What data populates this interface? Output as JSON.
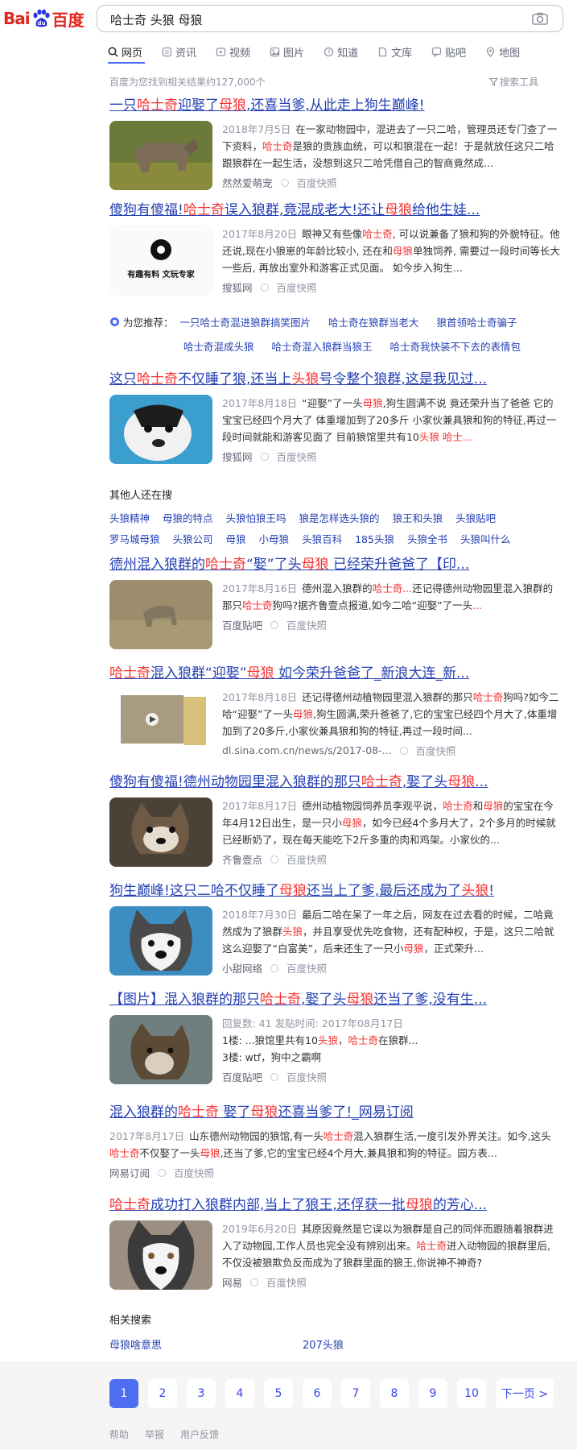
{
  "logo": {
    "part1": "Bai",
    "part2": "百度"
  },
  "search": {
    "query": "哈士奇 头狼 母狼"
  },
  "tabs": [
    {
      "label": "网页",
      "icon": "search-icon",
      "active": true
    },
    {
      "label": "资讯",
      "icon": "news-icon"
    },
    {
      "label": "视频",
      "icon": "video-icon"
    },
    {
      "label": "图片",
      "icon": "image-icon"
    },
    {
      "label": "知道",
      "icon": "question-icon"
    },
    {
      "label": "文库",
      "icon": "document-icon"
    },
    {
      "label": "贴吧",
      "icon": "forum-icon"
    },
    {
      "label": "地图",
      "icon": "map-icon"
    }
  ],
  "result_count": "百度为您找到相关结果约127,000个",
  "tools_label": "搜索工具",
  "results": [
    {
      "title": [
        [
          "一只",
          ""
        ],
        [
          "哈士奇",
          "hl"
        ],
        [
          "迎娶了",
          ""
        ],
        [
          "母狼",
          "hl"
        ],
        [
          ",还喜当爹,从此走上狗生巅峰!",
          ""
        ]
      ],
      "text": [
        [
          "2018年7月5日",
          "date"
        ],
        [
          "在一家动物园中，混进去了一只二哈，管理员还专门查了一下资料，",
          ""
        ],
        [
          "哈士奇",
          "hl"
        ],
        [
          "是狼的贵族血统，可以和狼混在一起！于是就放任这只二哈跟狼群在一起生活，没想到这只二哈凭借自己的智商竟然成...",
          ""
        ]
      ],
      "source": "然然爱萌宠",
      "snap": "百度快照",
      "thumb": "wolf-grass"
    },
    {
      "title": [
        [
          "傻狗有傻福!",
          ""
        ],
        [
          "哈士奇",
          "hl"
        ],
        [
          "误入狼群,竟混成老大!还让",
          ""
        ],
        [
          "母狼",
          "hl"
        ],
        [
          "给他生娃...",
          ""
        ]
      ],
      "text": [
        [
          "2017年8月20日",
          "date"
        ],
        [
          "眼神又有些像",
          ""
        ],
        [
          "哈士奇",
          "hl"
        ],
        [
          ", 可以说兼备了狼和狗的外貌特征。他还说,现在小狼崽的年龄比较小, 还在和",
          ""
        ],
        [
          "母狼",
          "hl"
        ],
        [
          "单独饲养, 需要过一段时间等长大一些后, 再放出室外和游客正式见面。 如今步入狗生...",
          ""
        ]
      ],
      "source": "搜狐网",
      "snap": "百度快照",
      "thumb": "logo-card",
      "thumb_text": "有趣有料 文玩专家"
    },
    {
      "title": [
        [
          "这只",
          ""
        ],
        [
          "哈士奇",
          "hl"
        ],
        [
          "不仅睡了狼,还当上",
          ""
        ],
        [
          "头狼",
          "hl"
        ],
        [
          "号令整个狼群,这是我见过...",
          ""
        ]
      ],
      "text": [
        [
          "2017年8月18日",
          "date"
        ],
        [
          "“迎娶”了一头",
          ""
        ],
        [
          "母狼",
          "hl"
        ],
        [
          ",狗生圆满不说 竟还荣升当了爸爸 它的宝宝已经四个月大了 体重增加到了20多斤 小家伙兼具狼和狗的特征,再过一段时间就能和游客见面了 目前狼馆里共有10",
          ""
        ],
        [
          "头狼",
          "hl"
        ],
        [
          " ",
          ""
        ],
        [
          "哈士...",
          "hl"
        ]
      ],
      "source": "搜狐网",
      "snap": "百度快照",
      "thumb": "husky-face"
    },
    {
      "title": [
        [
          "德州混入狼群的",
          ""
        ],
        [
          "哈士奇",
          "hl"
        ],
        [
          "“娶”了头",
          ""
        ],
        [
          "母狼",
          "hl"
        ],
        [
          " 已经荣升爸爸了【印...",
          ""
        ]
      ],
      "text": [
        [
          "2017年8月16日",
          "date"
        ],
        [
          "德州混入狼群的",
          ""
        ],
        [
          "哈士奇...",
          "hl"
        ],
        [
          "还记得德州动物园里混入狼群的那只",
          ""
        ],
        [
          "哈士奇",
          "hl"
        ],
        [
          "狗吗?据齐鲁壹点报道,如今二哈“迎娶”了一头",
          ""
        ],
        [
          "...",
          "hl"
        ]
      ],
      "source": "百度贴吧",
      "snap": "百度快照",
      "thumb": "wolf-field"
    },
    {
      "title": [
        [
          "哈士奇",
          "hl"
        ],
        [
          "混入狼群“迎娶”",
          ""
        ],
        [
          "母狼",
          "hl"
        ],
        [
          " 如今荣升爸爸了_新浪大连_新...",
          ""
        ]
      ],
      "text": [
        [
          "2017年8月18日",
          "date"
        ],
        [
          "还记得德州动植物园里混入狼群的那只",
          ""
        ],
        [
          "哈士奇",
          "hl"
        ],
        [
          "狗吗?如今二哈“迎娶”了一头",
          ""
        ],
        [
          "母狼",
          "hl"
        ],
        [
          ",狗生圆满,荣升爸爸了,它的宝宝已经四个月大了,体重增加到了20多斤,小家伙兼具狼和狗的特征,再过一段时间...",
          ""
        ]
      ],
      "source": "dl.sina.com.cn/news/s/2017-08-...",
      "snap": "百度快照",
      "thumb": "video-card"
    },
    {
      "title": [
        [
          "傻狗有傻福!德州动物园里混入狼群的那只",
          ""
        ],
        [
          "哈士奇",
          "hl"
        ],
        [
          ",娶了头",
          ""
        ],
        [
          "母狼",
          "hl"
        ],
        [
          "...",
          ""
        ]
      ],
      "text": [
        [
          "2017年8月17日",
          "date"
        ],
        [
          "德州动植物园饲养员李观平说，",
          ""
        ],
        [
          "哈士奇",
          "hl"
        ],
        [
          "和",
          ""
        ],
        [
          "母狼",
          "hl"
        ],
        [
          "的宝宝在今年4月12日出生，是一只小",
          ""
        ],
        [
          "母狼",
          "hl"
        ],
        [
          "，如今已经4个多月大了，2个多月的时候就已经断奶了，现在每天能吃下2斤多重的肉和鸡架。小家伙的...",
          ""
        ]
      ],
      "source": "齐鲁壹点",
      "snap": "百度快照",
      "thumb": "wolf-pup"
    },
    {
      "title": [
        [
          "狗生巅峰!这只二哈不仅睡了",
          ""
        ],
        [
          "母狼",
          "hl"
        ],
        [
          "还当上了爹,最后还成为了",
          ""
        ],
        [
          "头狼",
          "hl"
        ],
        [
          "!",
          ""
        ]
      ],
      "text": [
        [
          "2018年7月30日",
          "date"
        ],
        [
          "最后二哈在呆了一年之后，网友在过去看的时候，二哈竟然成为了狼群",
          ""
        ],
        [
          "头狼",
          "hl"
        ],
        [
          "，并且享受优先吃食物，还有配种权，于是，这只二哈就这么迎娶了“白富美”，后来还生了一只小",
          ""
        ],
        [
          "母狼",
          "hl"
        ],
        [
          "，正式荣升...",
          ""
        ]
      ],
      "source": "小甜网络",
      "snap": "百度快照",
      "thumb": "husky-sad"
    },
    {
      "title": [
        [
          "【图片】混入狼群的那只",
          ""
        ],
        [
          "哈士奇",
          "hl"
        ],
        [
          ",娶了头",
          ""
        ],
        [
          "母狼",
          "hl"
        ],
        [
          "还当了爹,没有生...",
          ""
        ]
      ],
      "text": [
        [
          "回复数: 41 发贴时间: 2017年08月17日",
          "date"
        ],
        [
          "",
          ""
        ]
      ],
      "text2": [
        [
          "1楼: ...狼馆里共有10",
          ""
        ],
        [
          "头狼",
          "hl"
        ],
        [
          "，",
          ""
        ],
        [
          "哈士奇",
          "hl"
        ],
        [
          "在狼群...",
          ""
        ]
      ],
      "text3": "3楼: wtf，狗中之霸啊",
      "source": "百度贴吧",
      "snap": "百度快照",
      "thumb": "wolf-dark"
    },
    {
      "title": [
        [
          "混入狼群的",
          ""
        ],
        [
          "哈士奇",
          "hl"
        ],
        [
          " 娶了",
          ""
        ],
        [
          "母狼",
          "hl"
        ],
        [
          "还喜当爹了!_网易订阅",
          ""
        ]
      ],
      "text": [
        [
          "2017年8月17日",
          "date"
        ],
        [
          "山东德州动物园的狼馆,有一头",
          ""
        ],
        [
          "哈士奇",
          "hl"
        ],
        [
          "混入狼群生活,一度引发外界关注。如今,这头",
          ""
        ],
        [
          "哈士奇",
          "hl"
        ],
        [
          "不仅娶了一头",
          ""
        ],
        [
          "母狼",
          "hl"
        ],
        [
          ",还当了爹,它的宝宝已经4个月大,兼具狼和狗的特征。园方表...",
          ""
        ]
      ],
      "source": "网易订阅",
      "snap": "百度快照",
      "thumb": "none"
    },
    {
      "title": [
        [
          "哈士奇",
          "hl"
        ],
        [
          "成功打入狼群内部,当上了狼王,还俘获一批",
          ""
        ],
        [
          "母狼",
          "hl"
        ],
        [
          "的芳心...",
          ""
        ]
      ],
      "text": [
        [
          "2019年6月20日",
          "date"
        ],
        [
          "其原因竟然是它误以为狼群是自己的同伴而跟随着狼群进入了动物园,工作人员也完全没有辨别出来。",
          ""
        ],
        [
          "哈士奇",
          "hl"
        ],
        [
          "进入动物园的狼群里后,不仅没被狼欺负反而成为了狼群里面的狼王,你说神不神奇?",
          ""
        ]
      ],
      "source": "网易",
      "snap": "百度快照",
      "thumb": "husky-close"
    }
  ],
  "recommend": {
    "label": "为您推荐：",
    "row1": [
      "一只哈士奇混进狼群搞笑图片",
      "哈士奇在狼群当老大",
      "狼首领哈士奇骗子"
    ],
    "row2": [
      "哈士奇混成头狼",
      "哈士奇混入狼群当狼王",
      "哈士奇我快装不下去的表情包"
    ]
  },
  "others": {
    "title": "其他人还在搜",
    "row1": [
      "头狼精神",
      "母狼的特点",
      "头狼怕狼王吗",
      "狼是怎样选头狼的",
      "狼王和头狼",
      "头狼贴吧"
    ],
    "row2": [
      "罗马城母狼",
      "头狼公司",
      "母狼",
      "小母狼",
      "头狼百科",
      "185头狼",
      "头狼全书",
      "头狼叫什么"
    ]
  },
  "related": {
    "title": "相关搜索",
    "items": [
      "母狼啥意思",
      "207头狼"
    ]
  },
  "pager": {
    "pages": [
      "1",
      "2",
      "3",
      "4",
      "5",
      "6",
      "7",
      "8",
      "9",
      "10"
    ],
    "next": "下一页 >"
  },
  "footer": [
    "帮助",
    "举报",
    "用户反馈"
  ],
  "colors": {
    "link": "#2440b3",
    "highlight": "#f73131",
    "accent": "#4e6ef2",
    "brand": "#e1251b"
  }
}
